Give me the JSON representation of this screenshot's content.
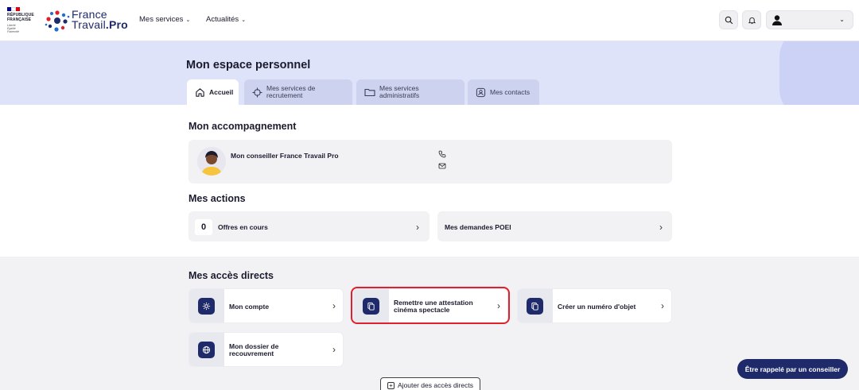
{
  "header": {
    "rf_logo_lines": [
      "RÉPUBLIQUE",
      "FRANÇAISE"
    ],
    "rf_motto": [
      "Liberté",
      "Égalité",
      "Fraternité"
    ],
    "brand_line1": "France",
    "brand_line2_a": "Travail",
    "brand_line2_b": ".Pro",
    "nav": [
      {
        "label": "Mes services",
        "chevron": "⌄"
      },
      {
        "label": "Actualités",
        "chevron": "⌄"
      }
    ],
    "icons": [
      "search-icon",
      "bell-icon",
      "user-icon",
      "chevron-down-icon"
    ],
    "user_chevron": "⌄"
  },
  "hero": {
    "title": "Mon espace personnel",
    "tabs": [
      {
        "label": "Accueil",
        "icon": "home-icon",
        "active": true
      },
      {
        "label": "Mes services de recrutement",
        "line1": "Mes services de",
        "line2": "recrutement",
        "icon": "crosshair-icon"
      },
      {
        "label": "Mes services administratifs",
        "line1": "Mes services",
        "line2": "administratifs",
        "icon": "folder-icon"
      },
      {
        "label": "Mes contacts",
        "icon": "contact-icon"
      }
    ]
  },
  "accompagnement": {
    "title": "Mon accompagnement",
    "advisor_name": "Mon conseiller France Travail Pro",
    "icons": [
      "avatar-illustration",
      "phone-icon",
      "mail-icon"
    ]
  },
  "actions": {
    "title": "Mes actions",
    "items": [
      {
        "count": "0",
        "label": "Offres en cours",
        "chevron": "›"
      },
      {
        "label": "Mes demandes POEI",
        "chevron": "›"
      }
    ]
  },
  "direct_access": {
    "title": "Mes accès directs",
    "items": [
      {
        "line1": "Mon compte",
        "icon": "gear-icon",
        "chevron": "›"
      },
      {
        "line1": "Remettre une attestation",
        "line2": "cinéma spectacle",
        "icon": "document-icon",
        "chevron": "›",
        "highlighted": true
      },
      {
        "line1": "Créer un numéro d'objet",
        "icon": "document-icon",
        "chevron": "›"
      },
      {
        "line1": "Mon dossier de",
        "line2": "recouvrement",
        "icon": "globe-icon",
        "chevron": "›"
      }
    ],
    "add_button": "Ajouter des accès directs"
  },
  "callback_button": "Être rappelé par un conseiller",
  "colors": {
    "brand_navy": "#1f2a6b",
    "hero_bg": "#dfe3fa",
    "highlight_red": "#e0202c",
    "card_bg": "#f2f2f5"
  }
}
